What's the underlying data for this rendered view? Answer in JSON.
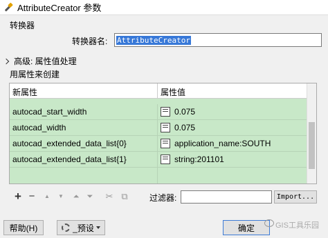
{
  "window": {
    "title": "AttributeCreator 参数",
    "icon": "fme-transformer-icon"
  },
  "transformer_group": {
    "label": "转换器",
    "name_label": "转换器名:",
    "name_value": "AttributeCreator"
  },
  "advanced": {
    "label": "高级: 属性值处理"
  },
  "new_attributes_group": {
    "label": "用属性来创建"
  },
  "table": {
    "columns": [
      "新属性",
      "属性值"
    ],
    "rows": [
      {
        "name": "autocad_start_width",
        "value": "0.075"
      },
      {
        "name": "autocad_width",
        "value": "0.075"
      },
      {
        "name": "autocad_extended_data_list{0}",
        "value": "application_name:SOUTH"
      },
      {
        "name": "autocad_extended_data_list{1}",
        "value": "string:201101"
      }
    ],
    "row_color": "#c8e8c8"
  },
  "toolbar": {
    "add": "+",
    "remove": "−",
    "move_up": "▲",
    "move_down": "▼",
    "move_top": "⏶",
    "move_bottom": "⏷",
    "cut": "✂",
    "copy": "⧉",
    "filter_label": "过滤器:",
    "filter_value": "",
    "import_label": "Import..."
  },
  "footer": {
    "help_label": "帮助(H)",
    "preset_label": "_预设",
    "ok_label": "确定",
    "watermark": "GIS工具乐园"
  }
}
